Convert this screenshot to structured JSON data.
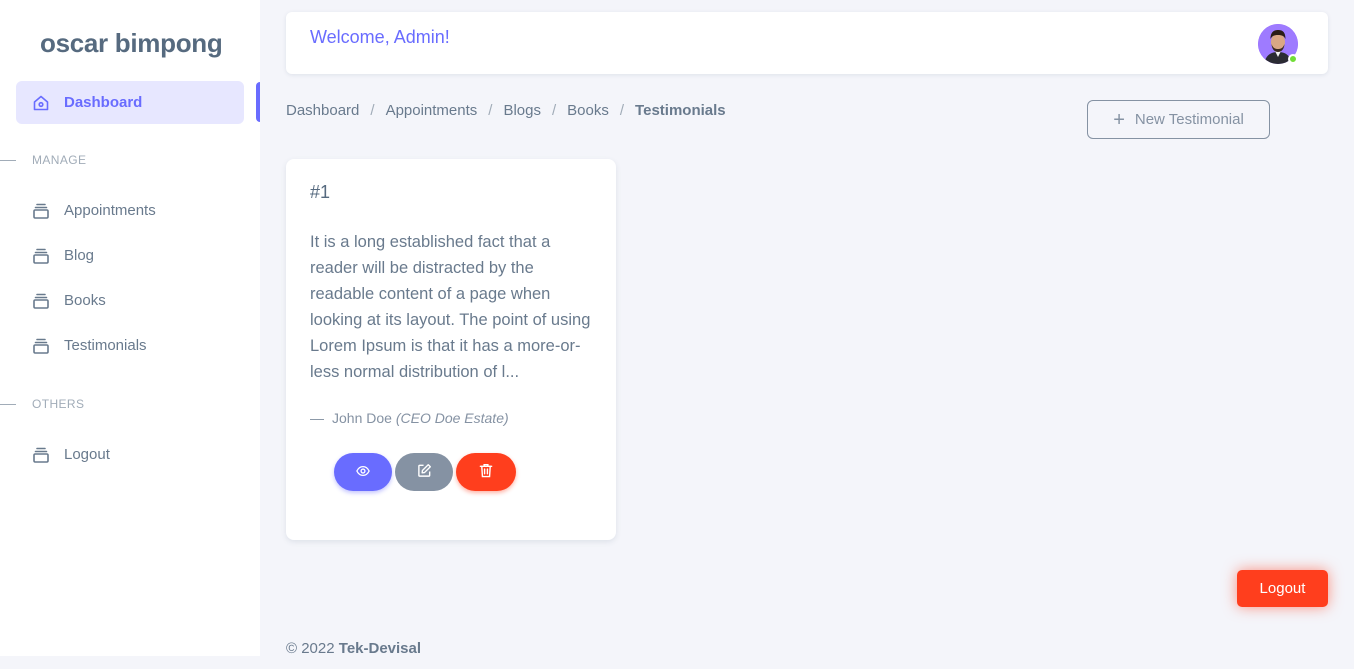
{
  "sidebar": {
    "brand": "oscar bimpong",
    "dashboard_label": "Dashboard",
    "manage_header": "MANAGE",
    "manage_items": [
      {
        "label": "Appointments"
      },
      {
        "label": "Blog"
      },
      {
        "label": "Books"
      },
      {
        "label": "Testimonials"
      }
    ],
    "others_header": "OTHERS",
    "logout_label": "Logout"
  },
  "navbar": {
    "welcome": "Welcome, Admin!"
  },
  "breadcrumb": [
    "Dashboard",
    "Appointments",
    "Blogs",
    "Books",
    "Testimonials"
  ],
  "actions": {
    "new_label": "New Testimonial"
  },
  "testimonial": {
    "number": "#1",
    "text": "It is a long established fact that a reader will be distracted by the readable content of a page when looking at its layout. The point of using Lorem Ipsum is that it has a more-or-less normal distribution of l...",
    "dash": "—",
    "author": "John Doe",
    "role": "(CEO Doe Estate)"
  },
  "logout_button": "Logout",
  "footer": {
    "copyright": "© 2022",
    "company": "Tek-Devisal"
  },
  "colors": {
    "primary": "#696cff",
    "danger": "#ff3e1d",
    "secondary": "#8592a3",
    "background": "#f4f5fa",
    "success": "#71dd37"
  }
}
